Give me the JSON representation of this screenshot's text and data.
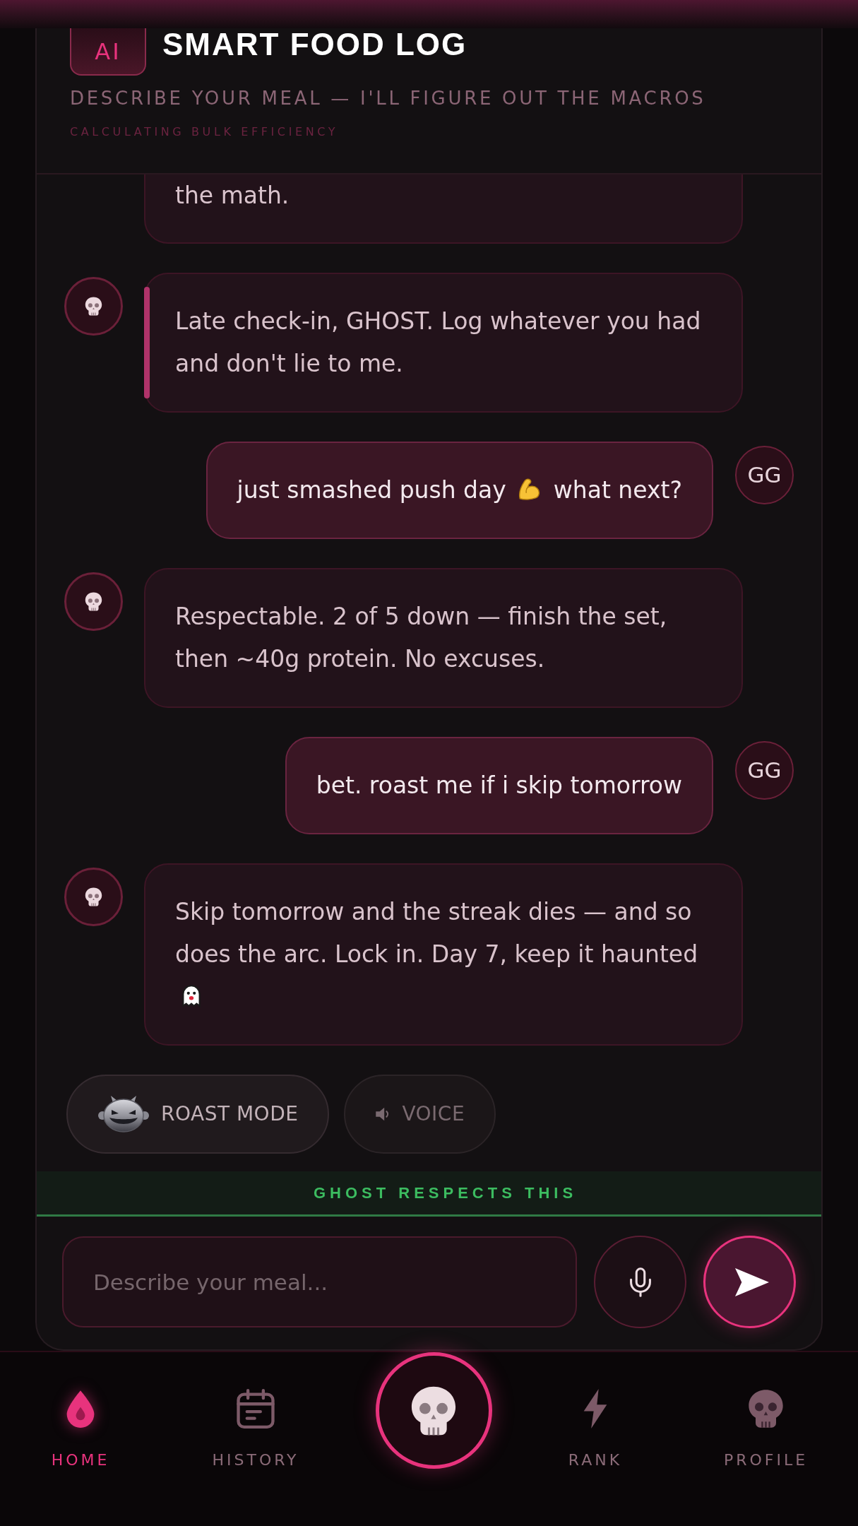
{
  "header": {
    "badge": "AI",
    "title": "SMART FOOD LOG",
    "subtitle": "DESCRIBE YOUR MEAL — I'LL FIGURE OUT THE MACROS",
    "status": "CALCULATING BULK EFFICIENCY"
  },
  "messages": [
    {
      "kind": "ai",
      "partial": true,
      "highlighted": false,
      "segments": [
        {
          "kind": "text",
          "text": "the math."
        }
      ]
    },
    {
      "kind": "ai",
      "partial": false,
      "highlighted": true,
      "segments": [
        {
          "kind": "text",
          "text": "Late check-in, GHOST. Log whatever you had and don't lie to me."
        }
      ]
    },
    {
      "kind": "user",
      "partial": false,
      "highlighted": false,
      "avatar": "GG",
      "segments": [
        {
          "kind": "text",
          "text": "just smashed push day"
        },
        {
          "kind": "biceps"
        },
        {
          "kind": "text",
          "text": "what next?"
        }
      ]
    },
    {
      "kind": "ai",
      "partial": false,
      "highlighted": false,
      "segments": [
        {
          "kind": "text",
          "text": "Respectable. 2 of 5 down — finish the set, then ~40g protein. No excuses."
        }
      ]
    },
    {
      "kind": "user",
      "partial": false,
      "highlighted": false,
      "avatar": "GG",
      "segments": [
        {
          "kind": "text",
          "text": "bet. roast me if i skip tomorrow"
        }
      ]
    },
    {
      "kind": "ai",
      "partial": false,
      "highlighted": false,
      "segments": [
        {
          "kind": "text",
          "text": "Skip tomorrow and the streak dies — and so does the arc. Lock in. Day 7, keep it haunted"
        },
        {
          "kind": "ghost"
        }
      ]
    }
  ],
  "toggles": [
    {
      "kind": "roast",
      "label": "ROAST MODE",
      "on": true
    },
    {
      "kind": "voice",
      "label": "VOICE",
      "on": false
    }
  ],
  "banner": "GHOST RESPECTS THIS",
  "composer": {
    "placeholder": "Describe your meal..."
  },
  "nav": [
    {
      "kind": "tab",
      "label": "HOME",
      "selected": true
    },
    {
      "kind": "tab",
      "label": "HISTORY",
      "selected": false
    },
    {
      "kind": "action"
    },
    {
      "kind": "tab",
      "label": "RANK",
      "selected": false
    },
    {
      "kind": "tab",
      "label": "PROFILE",
      "selected": false
    }
  ]
}
